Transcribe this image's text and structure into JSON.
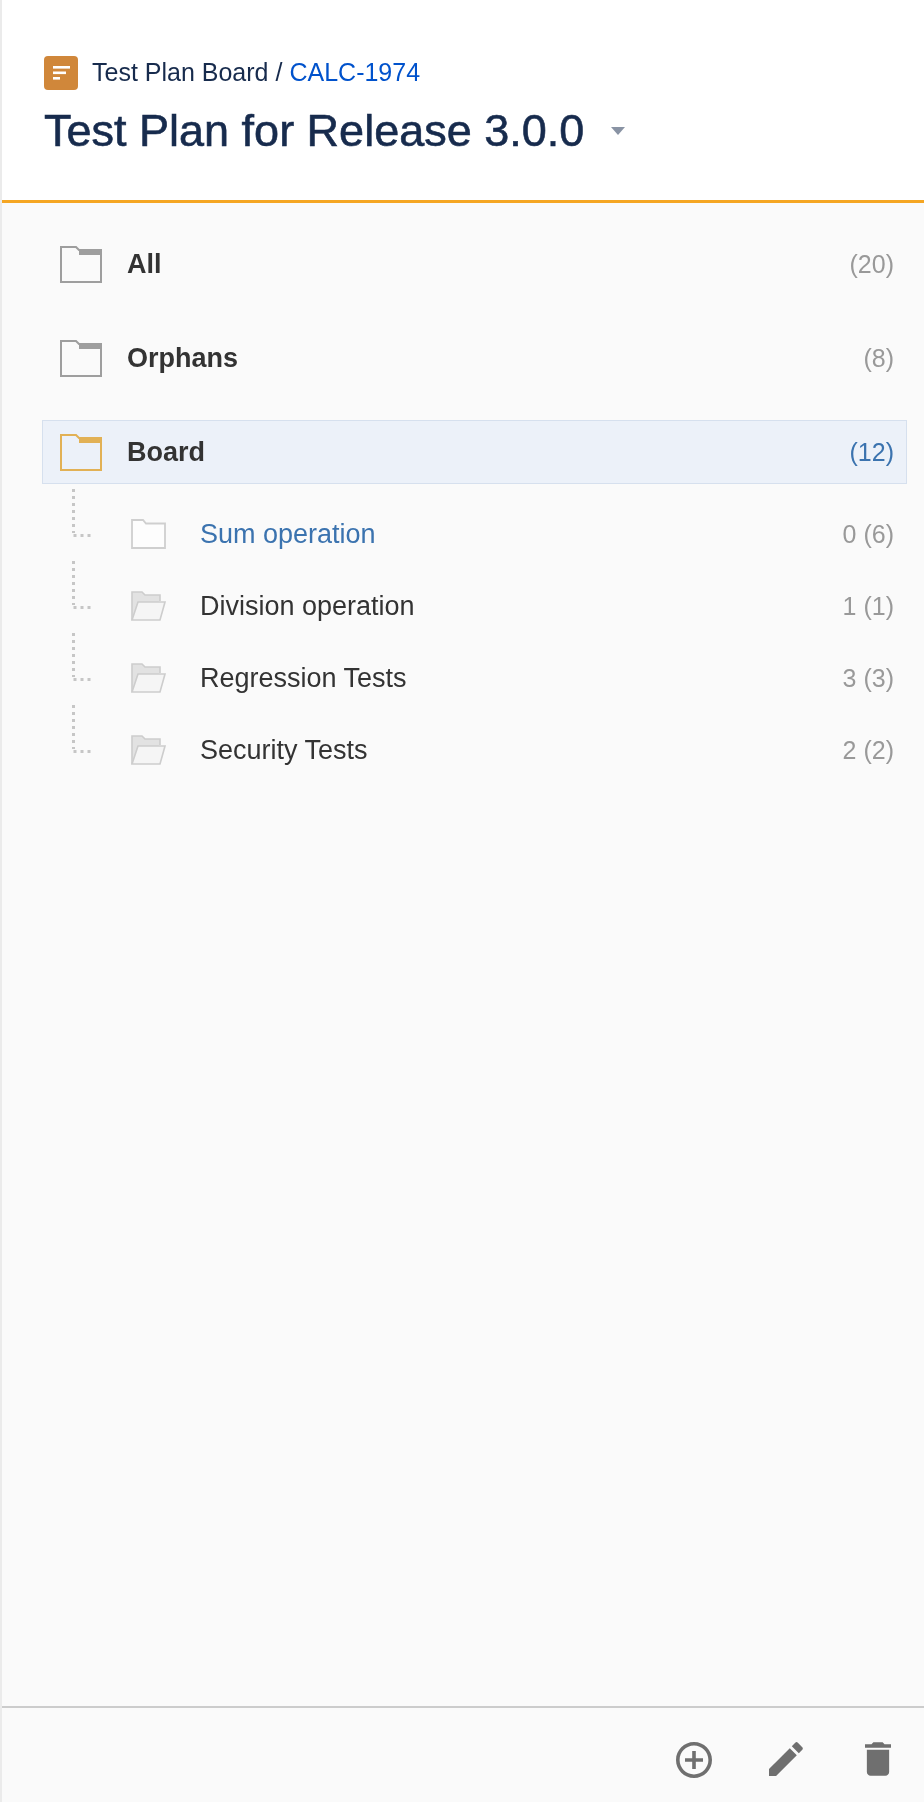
{
  "header": {
    "breadcrumb": {
      "board": "Test Plan Board",
      "separator": "/",
      "issue_key": "CALC-1974"
    },
    "title": "Test Plan for Release 3.0.0"
  },
  "tree": {
    "items": [
      {
        "name": "All",
        "count": "(20)",
        "selected": false
      },
      {
        "name": "Orphans",
        "count": "(8)",
        "selected": false
      },
      {
        "name": "Board",
        "count": "(12)",
        "selected": true,
        "children": [
          {
            "name": "Sum operation",
            "count": "0 (6)",
            "selected": false,
            "highlighted": true,
            "open": false
          },
          {
            "name": "Division operation",
            "count": "1 (1)",
            "selected": false,
            "highlighted": false,
            "open": true
          },
          {
            "name": "Regression Tests",
            "count": "3 (3)",
            "selected": false,
            "highlighted": false,
            "open": true
          },
          {
            "name": "Security Tests",
            "count": "2 (2)",
            "selected": false,
            "highlighted": false,
            "open": true
          }
        ]
      }
    ]
  }
}
